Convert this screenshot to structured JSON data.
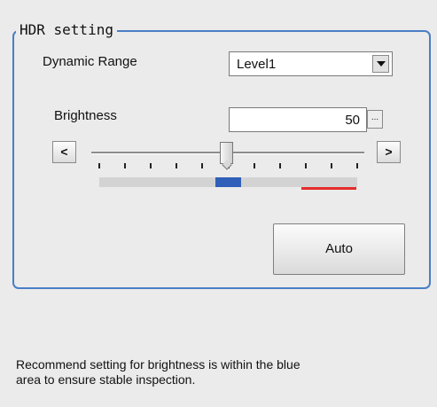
{
  "group": {
    "title": "HDR setting"
  },
  "dynamic_range": {
    "label": "Dynamic Range",
    "value": "Level1"
  },
  "brightness": {
    "label": "Brightness",
    "value": "50",
    "ellipsis": "...",
    "decrease": "<",
    "increase": ">",
    "slider_fraction": 0.5,
    "tick_count": 11,
    "recommended_range_fraction": [
      0.45,
      0.55
    ]
  },
  "auto_button": {
    "label": "Auto"
  },
  "message": {
    "line1": "Recommend setting for brightness is within the blue",
    "line2": "area to ensure stable inspection."
  },
  "colors": {
    "group_border": "#4a7ec6",
    "recommended_area": "#2f5fb8",
    "warning_line": "#e52b2b"
  }
}
